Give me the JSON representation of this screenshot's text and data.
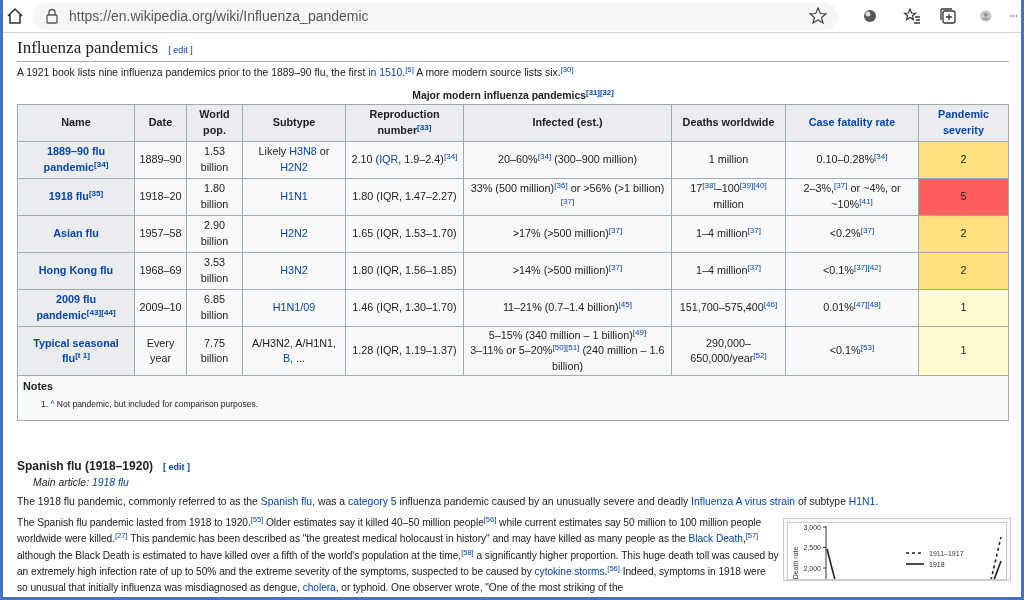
{
  "browser": {
    "url": "https://en.wikipedia.org/wiki/Influenza_pandemic"
  },
  "section": {
    "heading": "Influenza pandemics",
    "edit": "[ edit ]",
    "intro": [
      "A 1921 book lists nine influenza pandemics prior to the 1889–90 flu, the first ",
      {
        "link": "in 1510"
      },
      ".$^{[6]}$ A more modern source lists six.$^{[30]}$"
    ],
    "table": {
      "caption": "Major modern influenza pandemics$^{[31][32]}$",
      "columns": [
        {
          "label": [
            "Name"
          ]
        },
        {
          "label": [
            "Date"
          ]
        },
        {
          "label": [
            "World pop."
          ]
        },
        {
          "label": [
            "Subtype"
          ]
        },
        {
          "label": [
            "Reproduction number$^{[33]}$"
          ]
        },
        {
          "label": [
            "Infected (est.)"
          ]
        },
        {
          "label": [
            "Deaths worldwide"
          ]
        },
        {
          "label": [
            {
              "link": "Case fatality rate"
            }
          ]
        },
        {
          "label": [
            {
              "link": "Pandemic severity"
            }
          ]
        }
      ],
      "rows": [
        {
          "cells": [
            [
              {
                "link": "1889–90 flu pandemic$^{[34]}$"
              }
            ],
            [
              "1889–90"
            ],
            [
              "1.53 billion"
            ],
            [
              "Likely ",
              {
                "link": "H3N8"
              },
              " or ",
              {
                "link": "H2N2"
              }
            ],
            [
              "2.10 (",
              {
                "link": "IQR"
              },
              ", 1.9–2.4)$^{[34]}$"
            ],
            [
              "20–60%$^{[34]}$ (300–900 million)"
            ],
            [
              "1 million"
            ],
            [
              "0.10–0.28%$^{[34]}$"
            ]
          ],
          "severity": {
            "text": "2",
            "color": "#fee17d"
          }
        },
        {
          "cells": [
            [
              {
                "link": "1918 flu$^{[35]}$"
              }
            ],
            [
              "1918–20"
            ],
            [
              "1.80 billion"
            ],
            [
              {
                "link": "H1N1"
              }
            ],
            [
              "1.80 (IQR, 1.47–2.27)"
            ],
            [
              "33% (500 million)$^{[36]}$ or >56% (>1 billion)$^{[37]}$"
            ],
            [
              "17$^{[38]}$–100$^{[39][40]}$ million"
            ],
            [
              "2–3%,$^{[37]}$ or ~4%, or ~10%$^{[41]}$"
            ]
          ],
          "severity": {
            "text": "5",
            "color": "#ff5c5c"
          }
        },
        {
          "cells": [
            [
              {
                "link": "Asian flu"
              }
            ],
            [
              "1957–58"
            ],
            [
              "2.90 billion"
            ],
            [
              {
                "link": "H2N2"
              }
            ],
            [
              "1.65 (IQR, 1.53–1.70)"
            ],
            [
              ">17% (>500 million)$^{[37]}$"
            ],
            [
              "1–4 million$^{[37]}$"
            ],
            [
              "<0.2%$^{[37]}$"
            ]
          ],
          "severity": {
            "text": "2",
            "color": "#fee17d"
          }
        },
        {
          "cells": [
            [
              {
                "link": "Hong Kong flu"
              }
            ],
            [
              "1968–69"
            ],
            [
              "3.53 billion"
            ],
            [
              {
                "link": "H3N2"
              }
            ],
            [
              "1.80 (IQR, 1.56–1.85)"
            ],
            [
              ">14% (>500 million)$^{[37]}$"
            ],
            [
              "1–4 million$^{[37]}$"
            ],
            [
              "<0.1%$^{[37][42]}$"
            ]
          ],
          "severity": {
            "text": "2",
            "color": "#fee17d"
          }
        },
        {
          "cells": [
            [
              {
                "link": "2009 flu pandemic$^{[43][44]}$"
              }
            ],
            [
              "2009–10"
            ],
            [
              "6.85 billion"
            ],
            [
              {
                "link": "H1N1/09"
              }
            ],
            [
              "1.46 (IQR, 1.30–1.70)"
            ],
            [
              "11–21% (0.7–1.4 billion)$^{[45]}$"
            ],
            [
              "151,700–575,400$^{[46]}$"
            ],
            [
              "0.01%$^{[47][48]}$"
            ]
          ],
          "severity": {
            "text": "1",
            "color": "#fffdd0"
          }
        },
        {
          "cells": [
            [
              {
                "link": "Typical seasonal flu$^{[t 1]}$"
              }
            ],
            [
              "Every year"
            ],
            [
              "7.75 billion"
            ],
            [
              "A/H3N2, A/H1N1, ",
              {
                "link": "B"
              },
              ", ..."
            ],
            [
              "1.28 (IQR, 1.19–1.37)"
            ],
            [
              "5–15% (340 million – 1 billion)$^{[49]}$\n3–11% or 5–20%$^{[50][51]}$ (240 million – 1.6 billion)"
            ],
            [
              "290,000–650,000/year$^{[52]}$"
            ],
            [
              "<0.1%$^{[53]}$"
            ]
          ],
          "severity": {
            "text": "1",
            "color": "#fffdd0"
          }
        }
      ],
      "notes": {
        "heading": "Notes",
        "items": [
          [
            "1. ",
            {
              "link": "^"
            },
            " Not pandemic, but included for comparison purposes."
          ]
        ]
      }
    }
  },
  "subsection": {
    "heading": "Spanish flu (1918–1920)",
    "edit": "[ edit ]",
    "main_article": [
      "Main article: ",
      {
        "link": "1918 flu"
      }
    ],
    "paragraphs": [
      [
        "The 1918 flu pandemic, commonly referred to as the ",
        {
          "link": "Spanish flu"
        },
        ", was a ",
        {
          "link": "category 5"
        },
        " influenza pandemic caused by an unusually severe and deadly ",
        {
          "link": "Influenza A virus strain"
        },
        " of subtype ",
        {
          "link": "H1N1"
        },
        "."
      ],
      [
        "The Spanish flu pandemic lasted from 1918 to 1920.$^{[55]}$ Older estimates say it killed 40–50 million people$^{[56]}$ while current estimates say 50 million to 100 million people worldwide were killed.$^{[27]}$ This pandemic has been described as \"the greatest medical holocaust in history\" and may have killed as many people as the ",
        {
          "link": "Black Death"
        },
        ",$^{[57]}$ although the Black Death is estimated to have killed over a fifth of the world's population at the time,$^{[58]}$ a significantly higher proportion. This huge death toll was caused by an extremely high infection rate of up to 50% and the extreme severity of the symptoms, suspected to be caused by ",
        {
          "link": "cytokine storms"
        },
        ".$^{[56]}$ Indeed, symptoms in 1918 were so unusual that initially influenza was misdiagnosed as dengue, ",
        {
          "link": "cholera"
        },
        ", or typhoid. One observer wrote, \"One of the most striking of the"
      ]
    ],
    "figure": {
      "ylabel": "Death rate",
      "yticks": [
        "3,000",
        "2,500",
        "2,000"
      ],
      "legend": [
        {
          "label": "1911–1917",
          "kind": "dashed"
        },
        {
          "label": "1918",
          "kind": "solid"
        }
      ]
    }
  }
}
